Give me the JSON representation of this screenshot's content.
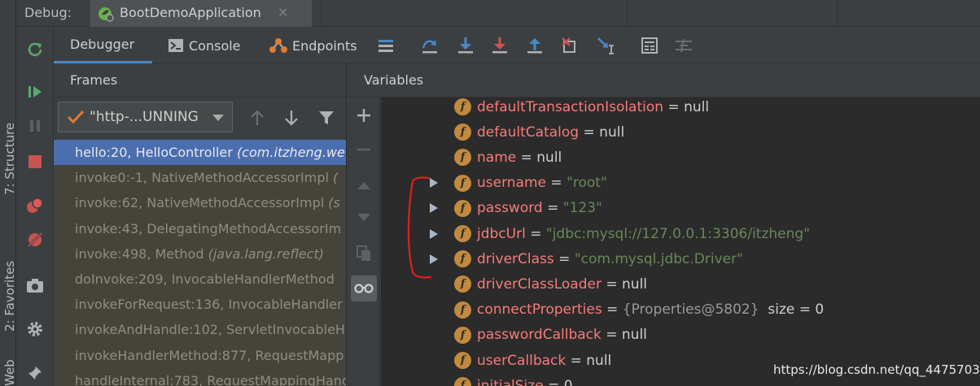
{
  "side_tools": {
    "structure_label": "7: Structure",
    "favorites_label": "2: Favorites",
    "web_label": "Web"
  },
  "title_bar": {
    "debug_label": "Debug:",
    "run_tab_name": "BootDemoApplication",
    "close_glyph": "×"
  },
  "tabs": {
    "debugger": "Debugger",
    "console": "Console",
    "endpoints": "Endpoints"
  },
  "frames": {
    "header": "Frames",
    "thread": "\"http-...UNNING",
    "items": [
      {
        "text": "hello:20, HelloController ",
        "pkg": "(com.itzheng.we"
      },
      {
        "text": "invoke0:-1, NativeMethodAccessorImpl ",
        "pkg": "("
      },
      {
        "text": "invoke:62, NativeMethodAccessorImpl ",
        "pkg": "(s"
      },
      {
        "text": "invoke:43, DelegatingMethodAccessorIm",
        "pkg": ""
      },
      {
        "text": "invoke:498, Method ",
        "pkg": "(java.lang.reflect)"
      },
      {
        "text": "doInvoke:209, InvocableHandlerMethod",
        "pkg": ""
      },
      {
        "text": "invokeForRequest:136, InvocableHandler",
        "pkg": ""
      },
      {
        "text": "invokeAndHandle:102, ServletInvocableH",
        "pkg": ""
      },
      {
        "text": "invokeHandlerMethod:877, RequestMapp",
        "pkg": ""
      },
      {
        "text": "handleInternal:783, RequestMappingHand",
        "pkg": ""
      }
    ]
  },
  "variables": {
    "header": "Variables",
    "items": [
      {
        "name": "defaultTransactionIsolation",
        "op": " = ",
        "value": "null",
        "kind": "null",
        "expandable": false
      },
      {
        "name": "defaultCatalog",
        "op": " = ",
        "value": "null",
        "kind": "null",
        "expandable": false
      },
      {
        "name": "name",
        "op": " = ",
        "value": "null",
        "kind": "null",
        "expandable": false
      },
      {
        "name": "username",
        "op": " = ",
        "value": "\"root\"",
        "kind": "str",
        "expandable": true
      },
      {
        "name": "password",
        "op": " = ",
        "value": "\"123\"",
        "kind": "str",
        "expandable": true
      },
      {
        "name": "jdbcUrl",
        "op": " = ",
        "value": "\"jdbc:mysql://127.0.0.1:3306/itzheng\"",
        "kind": "str",
        "expandable": true
      },
      {
        "name": "driverClass",
        "op": " = ",
        "value": "\"com.mysql.jdbc.Driver\"",
        "kind": "str",
        "expandable": true
      },
      {
        "name": "driverClassLoader",
        "op": " = ",
        "value": "null",
        "kind": "null",
        "expandable": false
      },
      {
        "name": "connectProperties",
        "op": " = ",
        "value": "{Properties@5802}",
        "extra": "  size = 0",
        "kind": "ref",
        "expandable": false
      },
      {
        "name": "passwordCallback",
        "op": " = ",
        "value": "null",
        "kind": "null",
        "expandable": false
      },
      {
        "name": "userCallback",
        "op": " = ",
        "value": "null",
        "kind": "null",
        "expandable": false
      },
      {
        "name": "initialSize",
        "op": " = ",
        "value": "0",
        "kind": "null",
        "expandable": false
      }
    ]
  },
  "watermark": "https://blog.csdn.net/qq_44757034",
  "colors": {
    "selected_frame": "#4b6eaf",
    "var_name": "#f77c7a",
    "string_value": "#6a8759",
    "annotation": "#e0201b",
    "accent_tab": "#4a88c7"
  }
}
